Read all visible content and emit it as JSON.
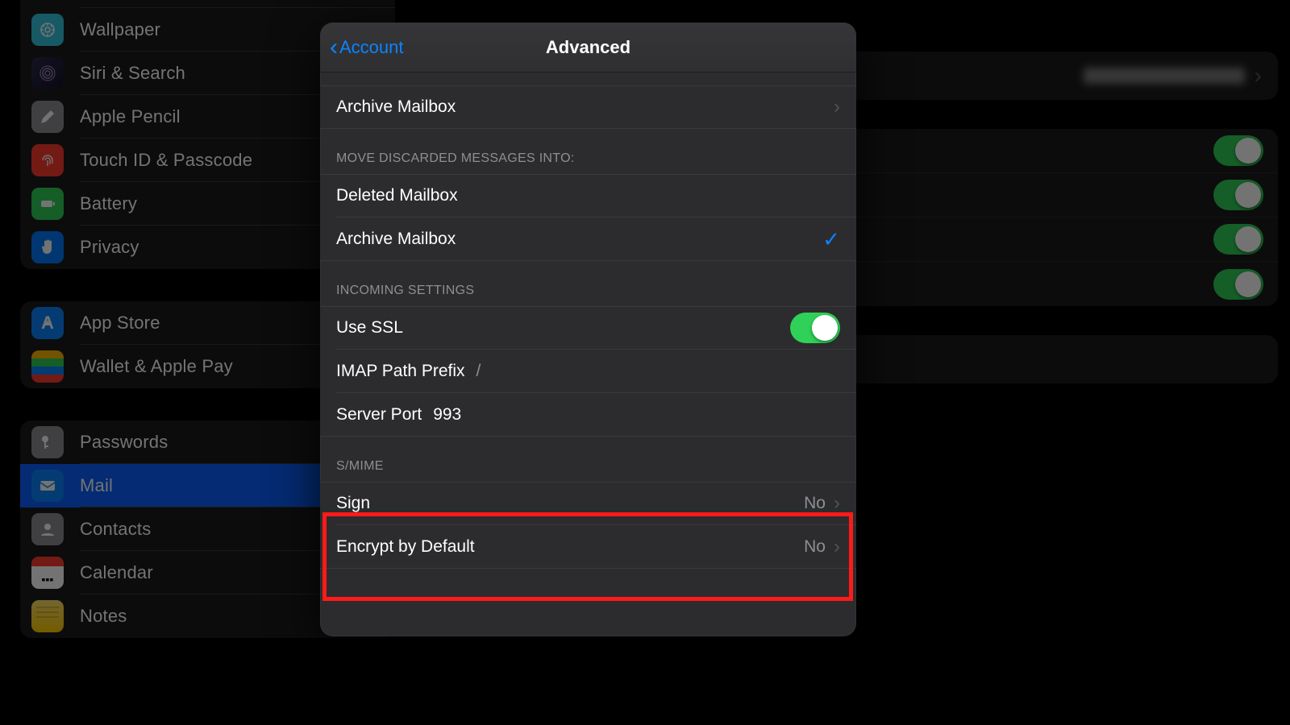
{
  "sidebar": {
    "group1": [
      {
        "label": "Wallpaper"
      },
      {
        "label": "Siri & Search"
      },
      {
        "label": "Apple Pencil"
      },
      {
        "label": "Touch ID & Passcode"
      },
      {
        "label": "Battery"
      },
      {
        "label": "Privacy"
      }
    ],
    "group2": [
      {
        "label": "App Store"
      },
      {
        "label": "Wallet & Apple Pay"
      }
    ],
    "group3": [
      {
        "label": "Passwords"
      },
      {
        "label": "Mail"
      },
      {
        "label": "Contacts"
      },
      {
        "label": "Calendar"
      },
      {
        "label": "Notes"
      }
    ]
  },
  "panel": {
    "back": "Account",
    "title": "Advanced",
    "archive_row": "Archive Mailbox",
    "section_discarded": "MOVE DISCARDED MESSAGES INTO:",
    "discard_options": [
      "Deleted Mailbox",
      "Archive Mailbox"
    ],
    "discard_selected_index": 1,
    "section_incoming": "INCOMING SETTINGS",
    "use_ssl_label": "Use SSL",
    "use_ssl_on": true,
    "imap_prefix_label": "IMAP Path Prefix",
    "imap_prefix_value": "/",
    "server_port_label": "Server Port",
    "server_port_value": "993",
    "section_smime": "S/MIME",
    "sign_label": "Sign",
    "sign_value": "No",
    "encrypt_label": "Encrypt by Default",
    "encrypt_value": "No"
  },
  "background_toggles": [
    true,
    true,
    true,
    true
  ]
}
